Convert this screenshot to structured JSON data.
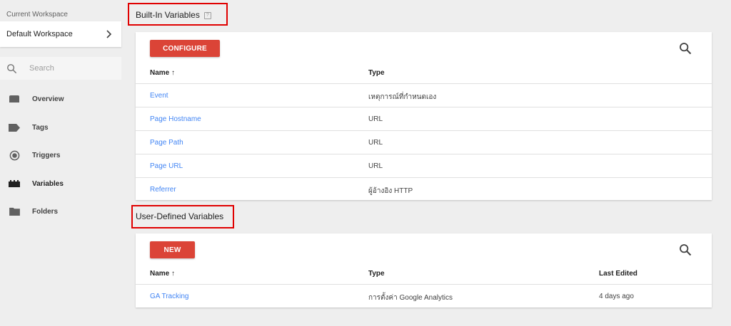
{
  "sidebar": {
    "workspace_label": "Current Workspace",
    "workspace_name": "Default Workspace",
    "search_placeholder": "Search",
    "items": [
      {
        "label": "Overview",
        "icon": "overview-icon"
      },
      {
        "label": "Tags",
        "icon": "tag-icon"
      },
      {
        "label": "Triggers",
        "icon": "trigger-icon"
      },
      {
        "label": "Variables",
        "icon": "variables-icon",
        "active": true
      },
      {
        "label": "Folders",
        "icon": "folder-icon"
      }
    ]
  },
  "builtin": {
    "title": "Built-In Variables",
    "help": "?",
    "button_label": "CONFIGURE",
    "columns": {
      "name": "Name ↑",
      "type": "Type"
    },
    "rows": [
      {
        "name": "Event",
        "type": "เหตุการณ์ที่กำหนดเอง"
      },
      {
        "name": "Page Hostname",
        "type": "URL"
      },
      {
        "name": "Page Path",
        "type": "URL"
      },
      {
        "name": "Page URL",
        "type": "URL"
      },
      {
        "name": "Referrer",
        "type": "ผู้อ้างอิง HTTP"
      }
    ]
  },
  "userdefined": {
    "title": "User-Defined Variables",
    "button_label": "NEW",
    "columns": {
      "name": "Name ↑",
      "type": "Type",
      "last_edited": "Last Edited"
    },
    "rows": [
      {
        "name": "GA Tracking",
        "type": "การตั้งค่า Google Analytics",
        "last_edited": "4 days ago"
      }
    ]
  },
  "colors": {
    "accent_red": "#db4437",
    "link_blue": "#4285f4",
    "highlight_box": "#e00000"
  }
}
